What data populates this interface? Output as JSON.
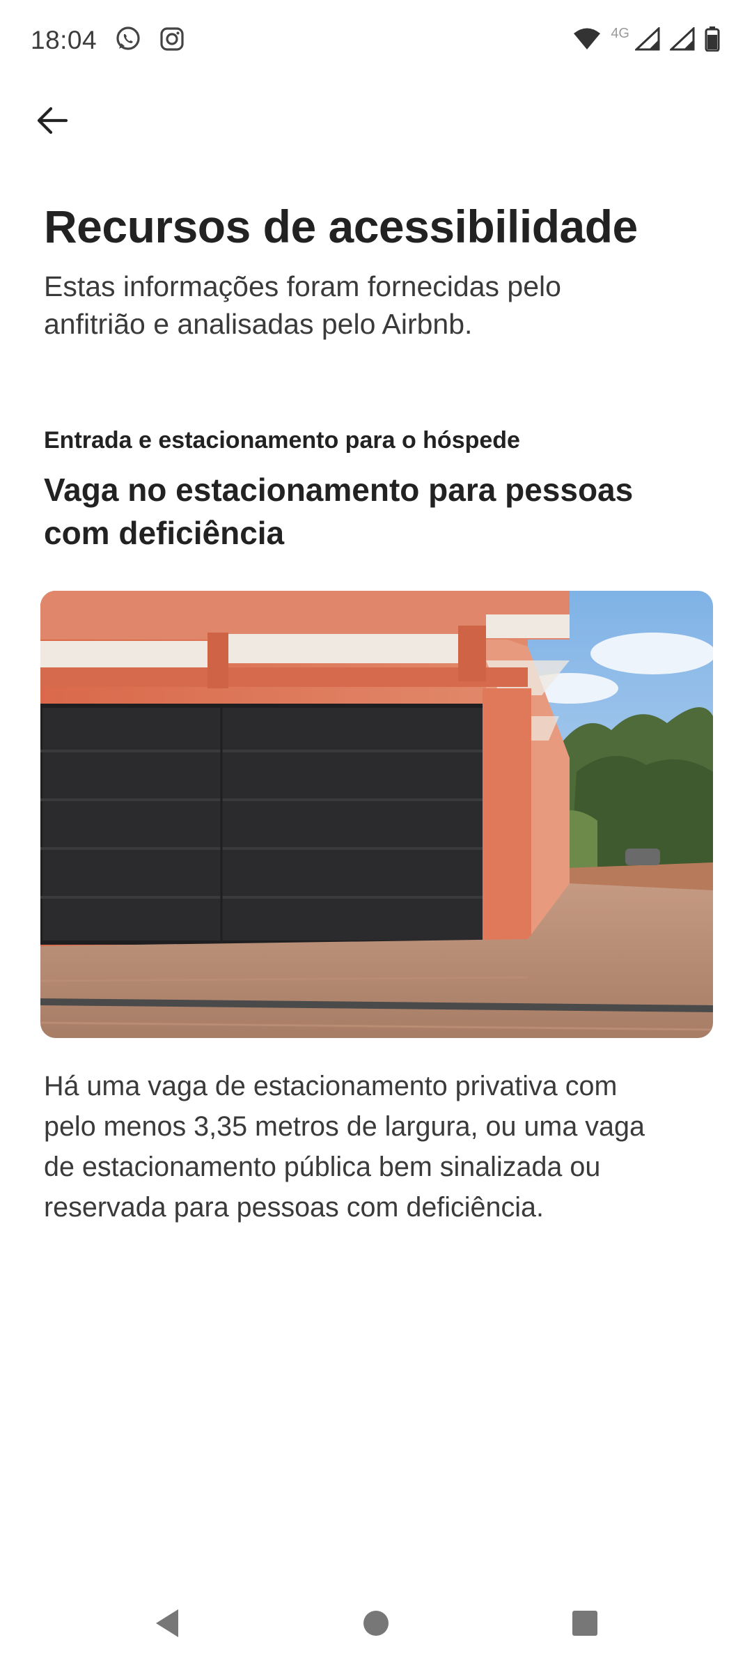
{
  "status_bar": {
    "time": "18:04",
    "network_label": "4G",
    "left_icons": [
      "whatsapp-icon",
      "instagram-icon"
    ],
    "right_icons": [
      "wifi-icon",
      "signal-icon",
      "signal-icon",
      "battery-icon"
    ]
  },
  "header": {
    "back_icon": "arrow-left-icon"
  },
  "page": {
    "title": "Recursos de acessibilidade",
    "subtitle_line1": "Estas informações foram fornecidas pelo",
    "subtitle_line2": "anfitrião e analisadas pelo Airbnb."
  },
  "feature": {
    "category": "Entrada e estacionamento para o hóspede",
    "title_line1": "Vaga no estacionamento para pessoas",
    "title_line2": "com deficiência",
    "description_lines": [
      "Há uma vaga de estacionamento privativa com",
      "pelo menos 3,35 metros de largura, ou uma vaga",
      "de estacionamento pública bem sinalizada ou",
      "reservada para pessoas com deficiência."
    ]
  },
  "nav_bar": {
    "icons": [
      "back-triangle-icon",
      "home-circle-icon",
      "recents-square-icon"
    ]
  },
  "colors": {
    "text_primary": "#222222",
    "text_secondary": "#3a3a3a",
    "background": "#ffffff"
  }
}
